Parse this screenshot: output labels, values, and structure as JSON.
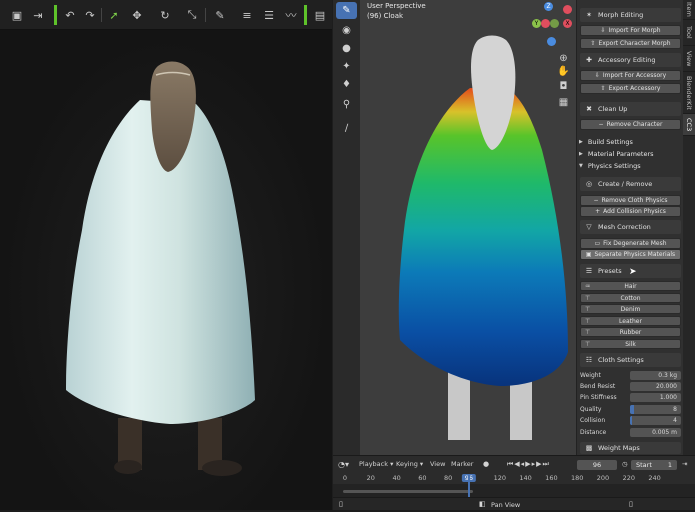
{
  "left_toolbar": {
    "icons": [
      "image-editor-icon",
      "render-region-icon",
      "undo-icon",
      "redo-icon",
      "select-cursor-icon",
      "move-icon",
      "rotate-icon",
      "scale-icon",
      "eraser-icon",
      "align-left-icon",
      "align-center-icon",
      "hair-curve-icon",
      "layout-icon"
    ]
  },
  "viewport": {
    "mode": "User Perspective",
    "object": "(96) Cloak"
  },
  "gizmo": {
    "z": "Z",
    "x": "X",
    "y": "Y"
  },
  "npanel_tabs": [
    "Item",
    "Tool",
    "View",
    "BlenderKit",
    "CC3"
  ],
  "active_tab": "CC3",
  "morph": {
    "header": "Morph Editing",
    "import": "Import For Morph",
    "export": "Export Character Morph"
  },
  "accessory": {
    "header": "Accessory Editing",
    "import": "Import For Accessory",
    "export": "Export Accessory"
  },
  "cleanup": {
    "header": "Clean Up",
    "remove": "Remove Character"
  },
  "subpanels": {
    "build": "Build Settings",
    "material": "Material Parameters",
    "physics": "Physics Settings"
  },
  "create_remove": {
    "header": "Create / Remove",
    "remove_cloth": "Remove Cloth Physics",
    "add_collision": "Add Collision Physics"
  },
  "mesh_correction": {
    "header": "Mesh Correction",
    "fix": "Fix Degenerate Mesh",
    "separate": "Separate Physics Materials"
  },
  "presets": {
    "header": "Presets",
    "items": [
      "Hair",
      "Cotton",
      "Denim",
      "Leather",
      "Rubber",
      "Silk"
    ]
  },
  "cloth_settings": {
    "header": "Cloth Settings",
    "rows": [
      {
        "label": "Weight",
        "value": "0.3 kg"
      },
      {
        "label": "Bend Resist",
        "value": "20.000"
      },
      {
        "label": "Pin Stiffness",
        "value": "1.000"
      },
      {
        "label": "Quality",
        "value": "8"
      },
      {
        "label": "Collision",
        "value": "4"
      },
      {
        "label": "Distance",
        "value": "0.005 m"
      }
    ],
    "quality_fill": 0.08,
    "collision_fill": 0.04
  },
  "weight_maps": "Weight Maps",
  "timeline": {
    "playback": "Playback",
    "keying": "Keying",
    "view": "View",
    "marker": "Marker",
    "current_frame": "96",
    "start_label": "Start",
    "start_value": "1",
    "ticks": [
      "0",
      "20",
      "40",
      "60",
      "80",
      "96",
      "120",
      "140",
      "160",
      "180",
      "200",
      "220",
      "240"
    ],
    "playhead": "96"
  },
  "status": {
    "pan_view": "Pan View"
  },
  "colors": {
    "accent": "#4772b3",
    "green_sep": "#5fc32a",
    "gizmo_x": "#e04e5e",
    "gizmo_y": "#8bc34a",
    "gizmo_z": "#4a8ce0"
  }
}
